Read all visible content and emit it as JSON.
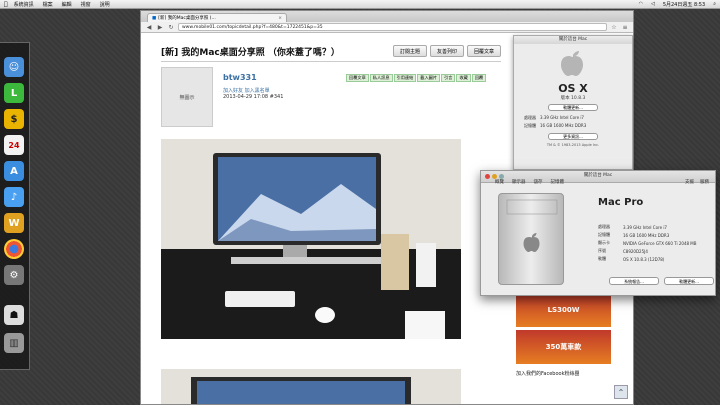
{
  "menubar": {
    "items": [
      "系統資訊",
      "檔案",
      "編輯",
      "視窗",
      "說明"
    ],
    "clock": "5月24日週五  8:53"
  },
  "browser": {
    "tab_title": "[新] 我的Mac桌面分享照 (...",
    "url": "www.mobile01.com/topicdetail.php?f=480&t=1722451&p=35"
  },
  "post": {
    "title": "[新] 我的Mac桌面分享照 （你來蓋了嗎？）",
    "title_buttons": [
      "訂閱主題",
      "友善列印",
      "回覆文章"
    ],
    "avatar_label": "無圖示",
    "username": "btw331",
    "user_links": "加入好友  加入黑名單",
    "date": "2013-04-29 17:08  #341",
    "actions": [
      "回覆文章",
      "私人訊息",
      "引用連結",
      "載入圖片",
      "引言",
      "收藏",
      "回覆"
    ]
  },
  "about_small": {
    "title": "關於這台 Mac",
    "os": "OS X",
    "version": "版本 10.8.3",
    "update_btn": "軟體更新...",
    "processor_label": "處理器",
    "processor": "3.39 GHz Intel Core i7",
    "memory_label": "記憶體",
    "memory": "16 GB 1600 MHz DDR3",
    "more_btn": "更多資訊...",
    "footer": "TM & © 1983-2013 Apple Inc."
  },
  "macpro": {
    "title": "關於這台 Mac",
    "tabs": [
      "概覽",
      "顯示器",
      "儲存",
      "記憶體"
    ],
    "right_tabs": [
      "支援",
      "服務"
    ],
    "heading": "Mac Pro",
    "specs": [
      {
        "k": "處理器",
        "v": "3.39 GHz Intel Core i7"
      },
      {
        "k": "記憶體",
        "v": "16 GB 1600 MHz DDR3"
      },
      {
        "k": "顯示卡",
        "v": "NVIDIA GeForce GTX 660 Ti 2048 MB"
      },
      {
        "k": "序號",
        "v": "C8920D25J4"
      },
      {
        "k": "軟體",
        "v": "OS X 10.8.3 (12D78)"
      }
    ],
    "buttons": [
      "系統報告...",
      "軟體更新..."
    ]
  },
  "ads": {
    "ad1": "LS300W",
    "ad2": "350萬車款",
    "fb": "加入我們的Facebook粉絲團"
  },
  "colors": {
    "link": "#3a6fa3",
    "desktop": "#3a3a3a"
  }
}
